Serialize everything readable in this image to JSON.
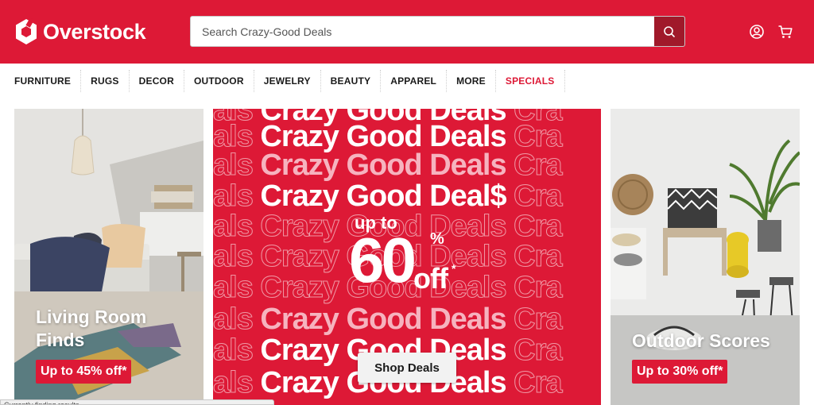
{
  "brand": {
    "name": "Overstock",
    "color": "#dd1936"
  },
  "search": {
    "placeholder": "Search Crazy-Good Deals",
    "button_icon": "search-icon"
  },
  "header_icons": [
    "account-icon",
    "cart-icon"
  ],
  "nav": [
    {
      "label": "FURNITURE"
    },
    {
      "label": "RUGS"
    },
    {
      "label": "DECOR"
    },
    {
      "label": "OUTDOOR"
    },
    {
      "label": "JEWELRY"
    },
    {
      "label": "BEAUTY"
    },
    {
      "label": "APPAREL"
    },
    {
      "label": "MORE"
    },
    {
      "label": "SPECIALS"
    }
  ],
  "tiles": {
    "left": {
      "line1": "Living Room",
      "line2": "Finds",
      "badge": "Up to 45% off*"
    },
    "right": {
      "title": "Outdoor Scores",
      "badge": "Up to 30% off*"
    }
  },
  "promo": {
    "phrase": "Crazy Good Deals",
    "headline": "Crazy Good Deal$",
    "up_to": "up to",
    "amount": "60",
    "percent": "%",
    "off": "off",
    "asterisk": "*",
    "button": "Shop Deals"
  },
  "status_text": "Currently finding results..."
}
